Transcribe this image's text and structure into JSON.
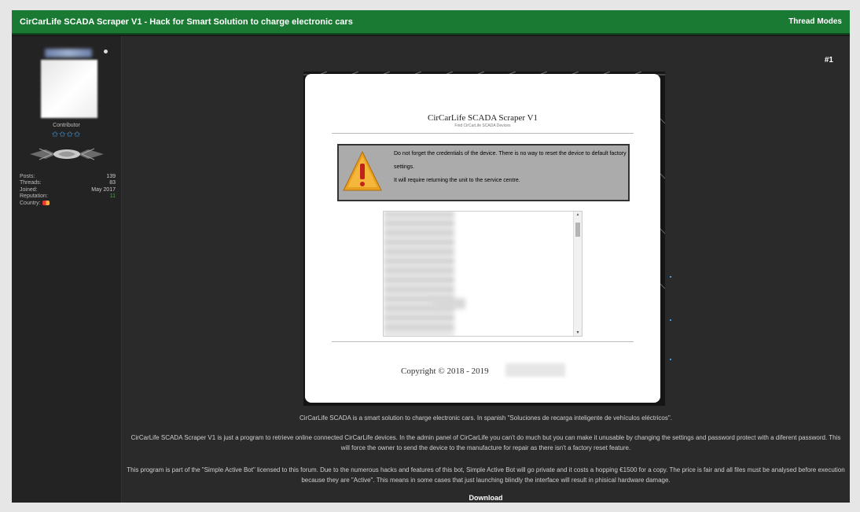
{
  "thread": {
    "title": "CirCarLife SCADA Scraper V1 - Hack for Smart Solution to charge electronic cars",
    "modes_label": "Thread Modes"
  },
  "user": {
    "title": "Contributor",
    "stars": "✩✩✩✩",
    "stats": [
      {
        "label": "Posts:",
        "value": "139"
      },
      {
        "label": "Threads:",
        "value": "83"
      },
      {
        "label": "Joined:",
        "value": "May 2017"
      },
      {
        "label": "Reputation:",
        "value": "11"
      }
    ],
    "country_label": "Country:"
  },
  "post": {
    "number": "#1",
    "app_title": "CirCarLife SCADA Scraper V1",
    "app_subtitle": "Find CirCarLife SCADA Devices",
    "warning_line1": "Do not forget the credentials of the device. There is no way to reset the device to default factory settings.",
    "warning_line2": "It will require returning the unit to the service centre.",
    "copyright": "Copyright © 2018 - 2019",
    "paragraphs": [
      "CirCarLife SCADA is a smart solution to charge electronic cars. In spanish \"Soluciones de recarga inteligente de vehículos eléctricos\".",
      "CirCarLife SCADA Scraper V1 is just a program to retrieve online connected CirCarLife devices. In the admin panel of CirCarLife you can't do much but you can make it unusable by changing the settings and password protect with a diferent password. This will force the owner to send the device to the manufacture for repair as there isn't a factory reset feature.",
      "This program is part of the \"Simple Active Bot\" licensed to this forum. Due to the numerous hacks and features of this bot, Simple Active Bot will go private and it costs a hopping €1500 for a copy. The price is fair and all files must be analysed before execution because they are \"Active\". This means in some cases that just launching blindly the interface will result in phisical hardware damage."
    ],
    "download_label": "Download"
  },
  "colors": {
    "header_green": "#1a7a33",
    "reputation_green": "#3caf3c",
    "star_blue": "#4aa3e8",
    "warning_orange": "#e8a020"
  }
}
